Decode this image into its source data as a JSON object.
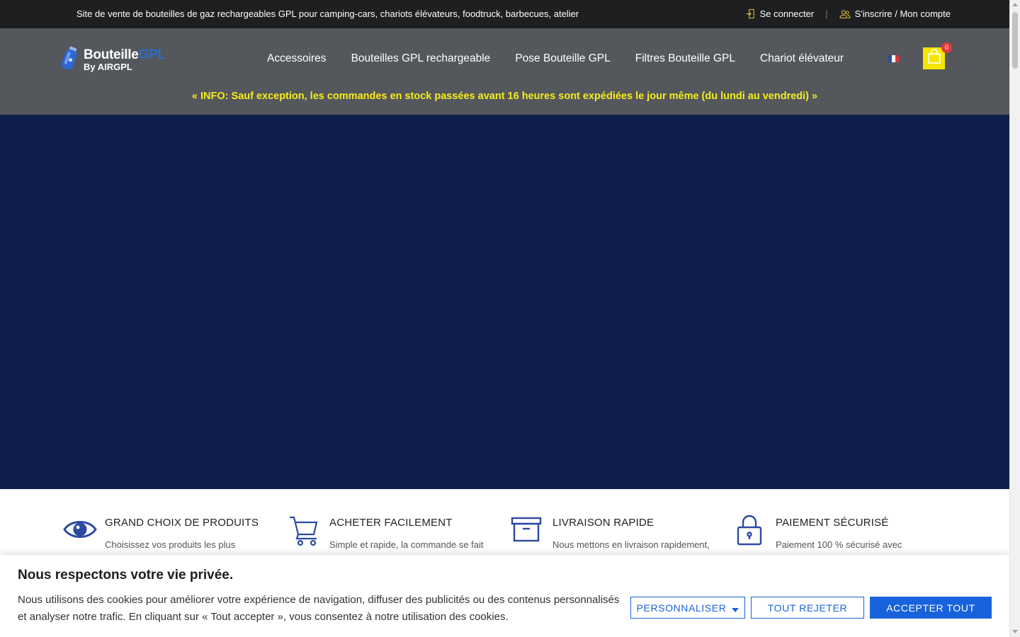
{
  "topbar": {
    "tagline": "Site de vente de bouteilles de gaz rechargeables GPL pour camping-cars, chariots élévateurs, foodtruck, barbecues, atelier",
    "login_label": "Se connecter",
    "separator": "|",
    "register_label": "S'inscrire / Mon compte",
    "icon_color": "#d6b23a"
  },
  "header": {
    "logo": {
      "line1_main": "Bouteille",
      "line1_accent": "GPL",
      "line2": "By AIRGPL"
    },
    "nav": [
      {
        "label": "Accessoires"
      },
      {
        "label": "Bouteilles GPL rechargeable"
      },
      {
        "label": "Pose Bouteille GPL"
      },
      {
        "label": "Filtres Bouteille GPL"
      },
      {
        "label": "Chariot élévateur"
      }
    ],
    "language": "fr-flag-icon",
    "cart_count": "0",
    "info": "« INFO: Sauf exception, les commandes en stock passées avant 16 heures sont expédiées le jour même (du lundi au vendredi) »"
  },
  "features": [
    {
      "icon": "eye-icon",
      "title": "GRAND CHOIX DE PRODUITS",
      "text": "Choisissez vos produits les plus"
    },
    {
      "icon": "cart-icon",
      "title": "ACHETER FACILEMENT",
      "text": "Simple et rapide, la commande se fait"
    },
    {
      "icon": "box-icon",
      "title": "LIVRAISON RAPIDE",
      "text": "Nous mettons en livraison rapidement,"
    },
    {
      "icon": "lock-icon",
      "title": "PAIEMENT SÉCURISÉ",
      "text": "Paiement 100 % sécurisé avec"
    }
  ],
  "cookie": {
    "title": "Nous respectons votre vie privée.",
    "text": "Nous utilisons des cookies pour améliorer votre expérience de navigation, diffuser des publicités ou des contenus personnalisés et analyser notre trafic. En cliquant sur « Tout accepter », vous consentez à notre utilisation des cookies.",
    "customize_label": "PERSONNALISER",
    "reject_label": "TOUT REJETER",
    "accept_label": "ACCEPTER TOUT"
  },
  "colors": {
    "topbar_bg": "#1e1f21",
    "header_bg": "#54575c",
    "hero_bg": "#0f1e4b",
    "info_text": "#f7ec1a",
    "cart_bg": "#f5e600",
    "feature_icon": "#2c4aa3",
    "cookie_button": "#1863dc"
  }
}
